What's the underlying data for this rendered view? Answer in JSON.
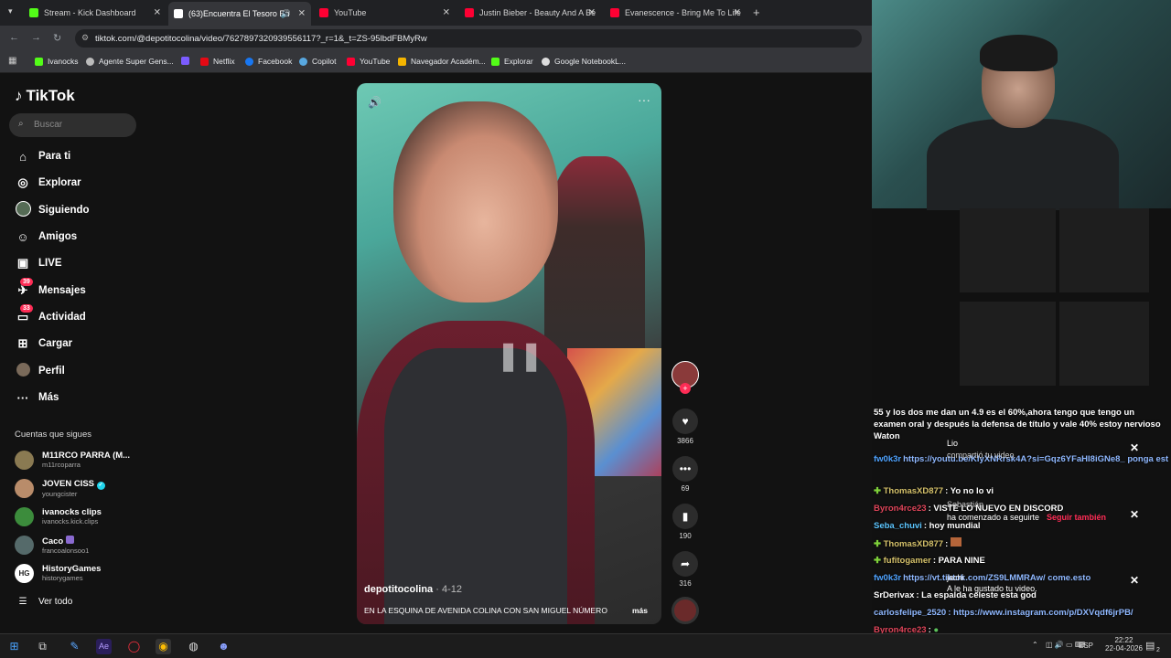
{
  "browser": {
    "tabs": [
      {
        "title": "Stream - Kick Dashboard",
        "color": "#53fc18"
      },
      {
        "title": "(63)Encuentra El Tesoro En",
        "color": "#ffffff"
      },
      {
        "title": "YouTube",
        "color": "#ff0033"
      },
      {
        "title": "Justin Bieber - Beauty And A Be",
        "color": "#ff0033"
      },
      {
        "title": "Evanescence - Bring Me To Life",
        "color": "#ff0033"
      }
    ],
    "new_tab": "+",
    "url": "tiktok.com/@depotitocolina/video/7627897320939556117?_r=1&_t=ZS-95lbdFBMyRw",
    "bookmarks": [
      {
        "label": "Ivanocks",
        "color": "#53fc18"
      },
      {
        "label": "Agente Super Gens...",
        "color": "#bbbbbb"
      },
      {
        "label": "",
        "color": "#7b5cff"
      },
      {
        "label": "Netflix",
        "color": "#e50914"
      },
      {
        "label": "Facebook",
        "color": "#1877f2"
      },
      {
        "label": "Copilot",
        "color": "#58a8e0"
      },
      {
        "label": "YouTube",
        "color": "#ff0033"
      },
      {
        "label": "Navegador Académ...",
        "color": "#f4b400"
      },
      {
        "label": "Explorar",
        "color": "#53fc18"
      },
      {
        "label": "Google NotebookL...",
        "color": "#dddddd"
      }
    ]
  },
  "tiktok": {
    "logo": "TikTok",
    "search_placeholder": "Buscar",
    "nav": [
      {
        "label": "Para ti",
        "icon": "home-icon",
        "glyph": "⌂"
      },
      {
        "label": "Explorar",
        "icon": "compass-icon",
        "glyph": "◎"
      },
      {
        "label": "Siguiendo",
        "icon": "following-avatar-icon",
        "glyph": "●"
      },
      {
        "label": "Amigos",
        "icon": "friends-icon",
        "glyph": "☺"
      },
      {
        "label": "LIVE",
        "icon": "live-icon",
        "glyph": "▣"
      },
      {
        "label": "Mensajes",
        "icon": "messages-icon",
        "glyph": "✈",
        "badge": "39"
      },
      {
        "label": "Actividad",
        "icon": "activity-icon",
        "glyph": "▭",
        "badge": "33"
      },
      {
        "label": "Cargar",
        "icon": "upload-icon",
        "glyph": "⊞"
      },
      {
        "label": "Perfil",
        "icon": "profile-icon",
        "glyph": "●"
      },
      {
        "label": "Más",
        "icon": "more-icon",
        "glyph": "···"
      }
    ],
    "following_header": "Cuentas que sigues",
    "following": [
      {
        "name": "M11RCO PARRA (M...",
        "handle": "m11rcoparra",
        "color": "#8a7a52"
      },
      {
        "name": "JOVEN CISS",
        "handle": "youngcister",
        "color": "#b98c6a"
      },
      {
        "name": "ivanocks clips",
        "handle": "ivanocks.kick.clips",
        "color": "#3c8c3c"
      },
      {
        "name": "Caco",
        "handle": "francoalonsoo1",
        "color": "#556a6a"
      },
      {
        "name": "HistoryGames",
        "handle": "historygames",
        "color": "#ffffff"
      }
    ],
    "see_all": "Ver todo",
    "video": {
      "username": "depotitocolina",
      "date": "· 4-12",
      "caption": "EN LA ESQUINA DE AVENIDA COLINA CON SAN MIGUEL NÚMERO",
      "more": "más"
    },
    "actions": [
      {
        "icon": "heart-icon",
        "glyph": "♥",
        "count": "3866"
      },
      {
        "icon": "comment-icon",
        "glyph": "•••",
        "count": "69"
      },
      {
        "icon": "bookmark-icon",
        "glyph": "▮",
        "count": "190"
      },
      {
        "icon": "share-icon",
        "glyph": "➦",
        "count": "316"
      }
    ]
  },
  "chat": {
    "messages": [
      {
        "user": "",
        "text": "55 y los dos me dan un 4.9 es el 60%,ahora tengo que tengo un examen oral y después la defensa de título y vale 40% estoy nervioso Waton",
        "user_color": "#ffffff"
      },
      {
        "user": "fw0k3r",
        "text": "https://youtu.be/KIyXNRrsk4A?si=Gqz6YFaHI8iGNe8_ ponga esta",
        "user_color": "#4fa3ff"
      },
      {
        "user": "ThomasXD877",
        "text": ": Yo no lo vi",
        "user_color": "#7fd13b"
      },
      {
        "user": "Byron4rce23",
        "text": ": VISTE LO NUEVO EN DISCORD",
        "user_color": "#e0455a"
      },
      {
        "user": "Seba_chuvi",
        "text": ": hoy mundial",
        "user_color": "#5cc6ff"
      },
      {
        "user": "ThomasXD877",
        "text": ":",
        "user_color": "#7fd13b"
      },
      {
        "user": "fufitogamer",
        "text": ": PARA NINE",
        "user_color": "#7fd13b"
      },
      {
        "user": "fw0k3r",
        "text": "https://vt.tiktok.com/ZS9LMMRAw/ come.esto",
        "user_color": "#4fa3ff"
      },
      {
        "user": "SrDerivax",
        "text": ": La espalda celeste esta god",
        "user_color": "#ffffff"
      },
      {
        "user": "carlosfelipe_2520",
        "text": ": https://www.instagram.com/p/DXVqdf6jrPB/",
        "user_color": "#8fb8ff"
      },
      {
        "user": "Byron4rce23",
        "text": ":",
        "user_color": "#e0455a"
      },
      {
        "user": "Byron4rce23",
        "text": ":",
        "user_color": "#e0455a"
      }
    ],
    "notifications": [
      {
        "name": "Lio",
        "text": "compartió tu video"
      },
      {
        "name": "Sebastián",
        "text": "ha comenzado a seguirte",
        "action": "Seguir también"
      },
      {
        "name": "jachi",
        "text": "A le ha gustado tu video."
      }
    ]
  },
  "taskbar": {
    "lang": "ESP",
    "time": "22:22",
    "date": "22-04-2026",
    "notif_count": "2"
  }
}
